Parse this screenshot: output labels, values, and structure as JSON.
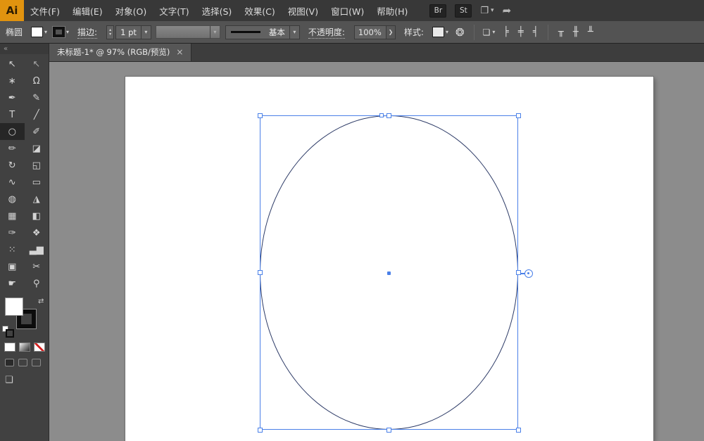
{
  "menubar": {
    "logo": "Ai",
    "items": [
      {
        "label": "文件(F)"
      },
      {
        "label": "编辑(E)"
      },
      {
        "label": "对象(O)"
      },
      {
        "label": "文字(T)"
      },
      {
        "label": "选择(S)"
      },
      {
        "label": "效果(C)"
      },
      {
        "label": "视图(V)"
      },
      {
        "label": "窗口(W)"
      },
      {
        "label": "帮助(H)"
      }
    ],
    "bridge_label": "Br",
    "stock_label": "St",
    "workspace_icon": "❐",
    "workspace_chevron": "▾",
    "share_icon": "➦"
  },
  "controlbar": {
    "tool_label": "椭圆",
    "fill_chevron": "▾",
    "stroke_chevron": "▾",
    "stroke_label": "描边:",
    "stepper_up": "▴",
    "stepper_down": "▾",
    "stroke_weight": "1 pt",
    "weight_chevron": "▾",
    "brush_chevron": "▾",
    "profile_label": "基本",
    "profile_chevron": "▾",
    "opacity_label": "不透明度:",
    "opacity_value": "100%",
    "opacity_arrow": "❯",
    "style_label": "样式:",
    "style_chevron": "▾",
    "recolor_icon": "❂",
    "align_dropdown_icon": "❏",
    "align_dropdown_chevron": "▾",
    "align_icons": [
      "╞",
      "╪",
      "╡",
      "╥",
      "╫",
      "╨"
    ]
  },
  "tabbar": {
    "title": "未标题-1* @ 97% (RGB/预览)",
    "close_icon": "×"
  },
  "toolpanel": {
    "collapse_icon": "«",
    "swap_icon": "⇄",
    "screen_mode_icon": "❏",
    "tools": [
      {
        "name": "selection",
        "glyph": "↖"
      },
      {
        "name": "direct-selection",
        "glyph": "↖"
      },
      {
        "name": "magic-wand",
        "glyph": "∗"
      },
      {
        "name": "lasso",
        "glyph": "Ω"
      },
      {
        "name": "pen",
        "glyph": "✒"
      },
      {
        "name": "curvature",
        "glyph": "✎"
      },
      {
        "name": "type",
        "glyph": "T"
      },
      {
        "name": "line-segment",
        "glyph": "╱"
      },
      {
        "name": "ellipse",
        "glyph": "○"
      },
      {
        "name": "paintbrush",
        "glyph": "✐"
      },
      {
        "name": "pencil",
        "glyph": "✏"
      },
      {
        "name": "eraser",
        "glyph": "◪"
      },
      {
        "name": "rotate",
        "glyph": "↻"
      },
      {
        "name": "scale",
        "glyph": "◱"
      },
      {
        "name": "width",
        "glyph": "∿"
      },
      {
        "name": "free-transform",
        "glyph": "▭"
      },
      {
        "name": "shape-builder",
        "glyph": "◍"
      },
      {
        "name": "perspective-grid",
        "glyph": "◮"
      },
      {
        "name": "mesh",
        "glyph": "▦"
      },
      {
        "name": "gradient",
        "glyph": "◧"
      },
      {
        "name": "eyedropper",
        "glyph": "✑"
      },
      {
        "name": "blend",
        "glyph": "❖"
      },
      {
        "name": "symbol-sprayer",
        "glyph": "⁙"
      },
      {
        "name": "column-graph",
        "glyph": "▃▆"
      },
      {
        "name": "artboard",
        "glyph": "▣"
      },
      {
        "name": "slice",
        "glyph": "✂"
      },
      {
        "name": "hand",
        "glyph": "☛"
      },
      {
        "name": "zoom",
        "glyph": "⚲"
      }
    ]
  },
  "document": {
    "name": "未标题-1",
    "zoom": "97%",
    "color_mode": "RGB",
    "view_mode": "预览",
    "active_tool": "椭圆"
  },
  "colors": {
    "selection_accent": "#4a80e8",
    "ellipse_stroke": "#2c3a66",
    "artboard": "#ffffff",
    "pasteboard": "#8c8c8c",
    "ui_dark": "#383838",
    "ui_mid": "#535353",
    "logo_amber": "#e1930f"
  }
}
